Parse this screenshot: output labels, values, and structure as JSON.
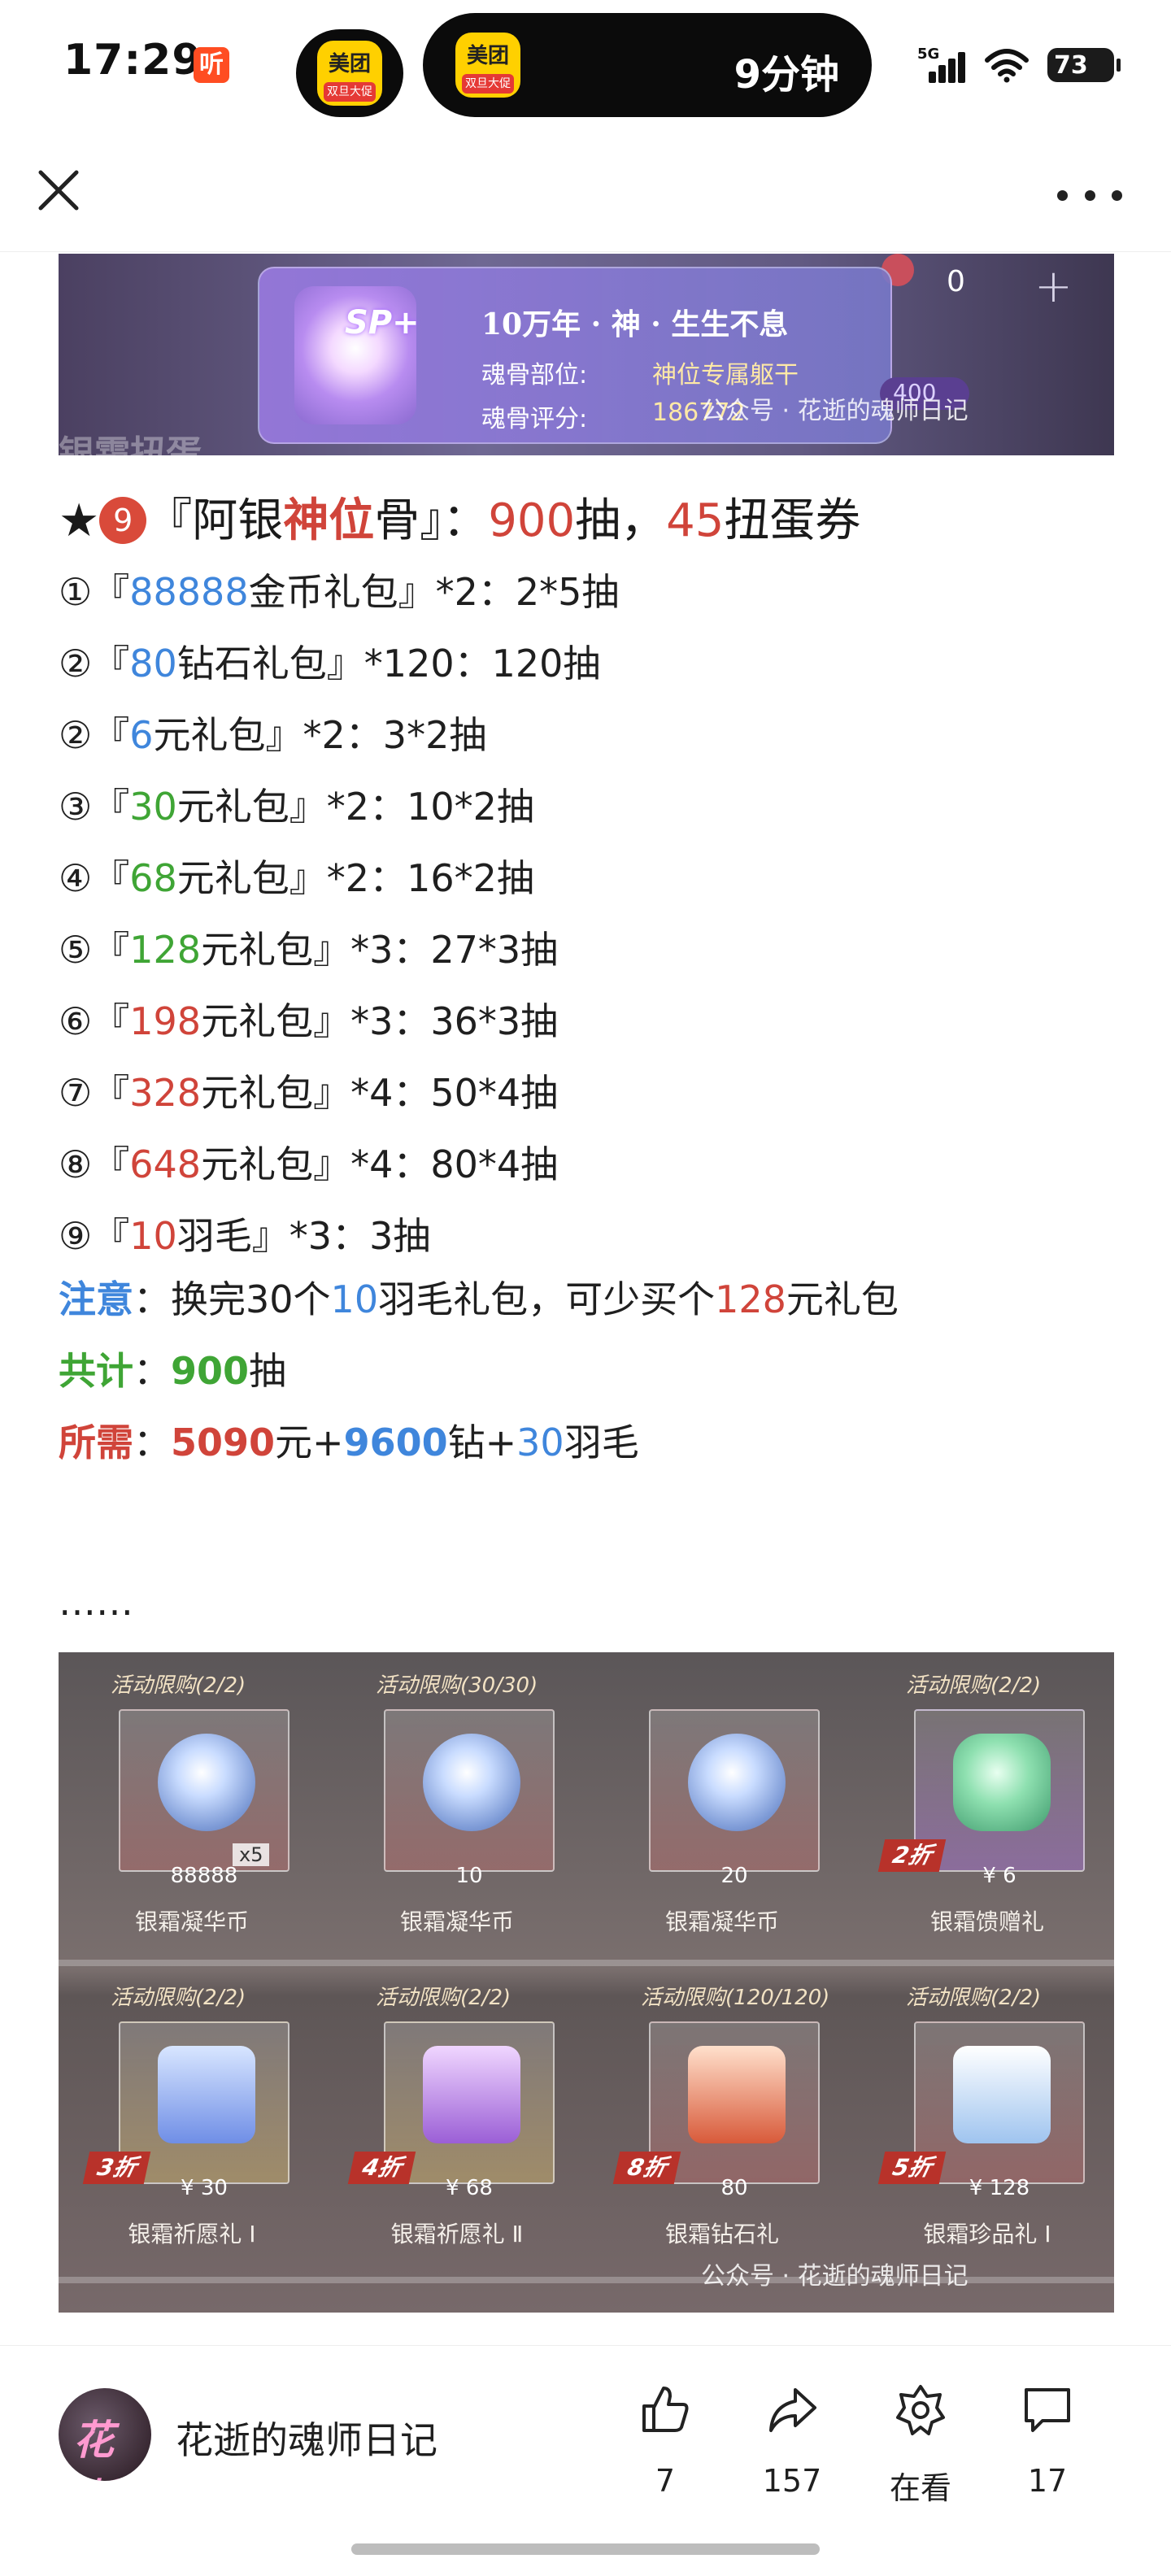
{
  "status_bar": {
    "time": "17:29",
    "ting_label": "听",
    "app_badge_top": "美团",
    "app_badge_bottom": "双旦大促",
    "island_text": "9分钟",
    "network": "5G",
    "battery": "73"
  },
  "nav": {
    "close_icon": "close-icon",
    "more_icon": "more-icon"
  },
  "top_image": {
    "badge": "SP+",
    "title": "10万年 · 神 · 生生不息",
    "part_label": "魂骨部位:",
    "part_value": "神位专属躯干",
    "score_label": "魂骨评分:",
    "score_value": "186772",
    "counter": "0",
    "pill": "400",
    "bg_text": "银霜扭蛋",
    "watermark": "公众号 · 花逝的魂师日记"
  },
  "headline": {
    "star": "★",
    "badge": "9",
    "p1": "『阿银",
    "p2": "神位",
    "p3": "骨』：",
    "p4": "900",
    "p5": "抽，",
    "p6": "45",
    "p7": "扭蛋券"
  },
  "items": [
    {
      "n": "①『",
      "v": "88888",
      "t": "金币礼包』*2：2*5抽",
      "color": "#3f86dc"
    },
    {
      "n": "②『",
      "v": "80",
      "t": "钻石礼包』*120：120抽",
      "color": "#3f86dc"
    },
    {
      "n": "②『",
      "v": "6",
      "t": "元礼包』*2：3*2抽",
      "color": "#3f86dc"
    },
    {
      "n": "③『",
      "v": "30",
      "t": "元礼包』*2：10*2抽",
      "color": "#3fa535"
    },
    {
      "n": "④『",
      "v": "68",
      "t": "元礼包』*2：16*2抽",
      "color": "#3fa535"
    },
    {
      "n": "⑤『",
      "v": "128",
      "t": "元礼包』*3：27*3抽",
      "color": "#3fa535"
    },
    {
      "n": "⑥『",
      "v": "198",
      "t": "元礼包』*3：36*3抽",
      "color": "#d0443a"
    },
    {
      "n": "⑦『",
      "v": "328",
      "t": "元礼包』*4：50*4抽",
      "color": "#d0443a"
    },
    {
      "n": "⑧『",
      "v": "648",
      "t": "元礼包』*4：80*4抽",
      "color": "#d0443a"
    },
    {
      "n": "⑨『",
      "v": "10",
      "t": "羽毛』*3：3抽",
      "color": "#d0443a"
    }
  ],
  "note": {
    "label": "注意",
    "t1": "：换完30个",
    "v1": "10",
    "t2": "羽毛礼包，可少买个",
    "v2": "128",
    "t3": "元礼包"
  },
  "total": {
    "label": "共计",
    "colon": "：",
    "value": "900",
    "unit": "抽"
  },
  "required": {
    "label": "所需",
    "colon": "：",
    "v1": "5090",
    "t1": "元+",
    "v2": "9600",
    "t2": "钻+",
    "v3": "30",
    "t3": "羽毛"
  },
  "ellipsis": "……",
  "shop_image": {
    "watermark": "公众号 · 花逝的魂师日记",
    "items": [
      {
        "tag": "活动限购(2/2)",
        "price": "88888",
        "name": "银霜凝华币",
        "discount": "",
        "extra": "x5"
      },
      {
        "tag": "活动限购(30/30)",
        "price": "10",
        "name": "银霜凝华币",
        "discount": "",
        "extra": ""
      },
      {
        "tag": "",
        "price": "20",
        "name": "银霜凝华币",
        "discount": "",
        "extra": ""
      },
      {
        "tag": "活动限购(2/2)",
        "price": "¥ 6",
        "name": "银霜馈赠礼",
        "discount": "2折",
        "extra": ""
      },
      {
        "tag": "活动限购(2/2)",
        "price": "¥ 30",
        "name": "银霜祈愿礼 Ⅰ",
        "discount": "3折",
        "extra": ""
      },
      {
        "tag": "活动限购(2/2)",
        "price": "¥ 68",
        "name": "银霜祈愿礼 Ⅱ",
        "discount": "4折",
        "extra": ""
      },
      {
        "tag": "活动限购(120/120)",
        "price": "80",
        "name": "银霜钻石礼",
        "discount": "8折",
        "extra": ""
      },
      {
        "tag": "活动限购(2/2)",
        "price": "¥ 128",
        "name": "银霜珍品礼 Ⅰ",
        "discount": "5折",
        "extra": ""
      }
    ]
  },
  "bottom_bar": {
    "avatar_text": "花逝",
    "account_name": "花逝的魂师日记",
    "like_count": "7",
    "share_count": "157",
    "watching_label": "在看",
    "comment_count": "17"
  }
}
